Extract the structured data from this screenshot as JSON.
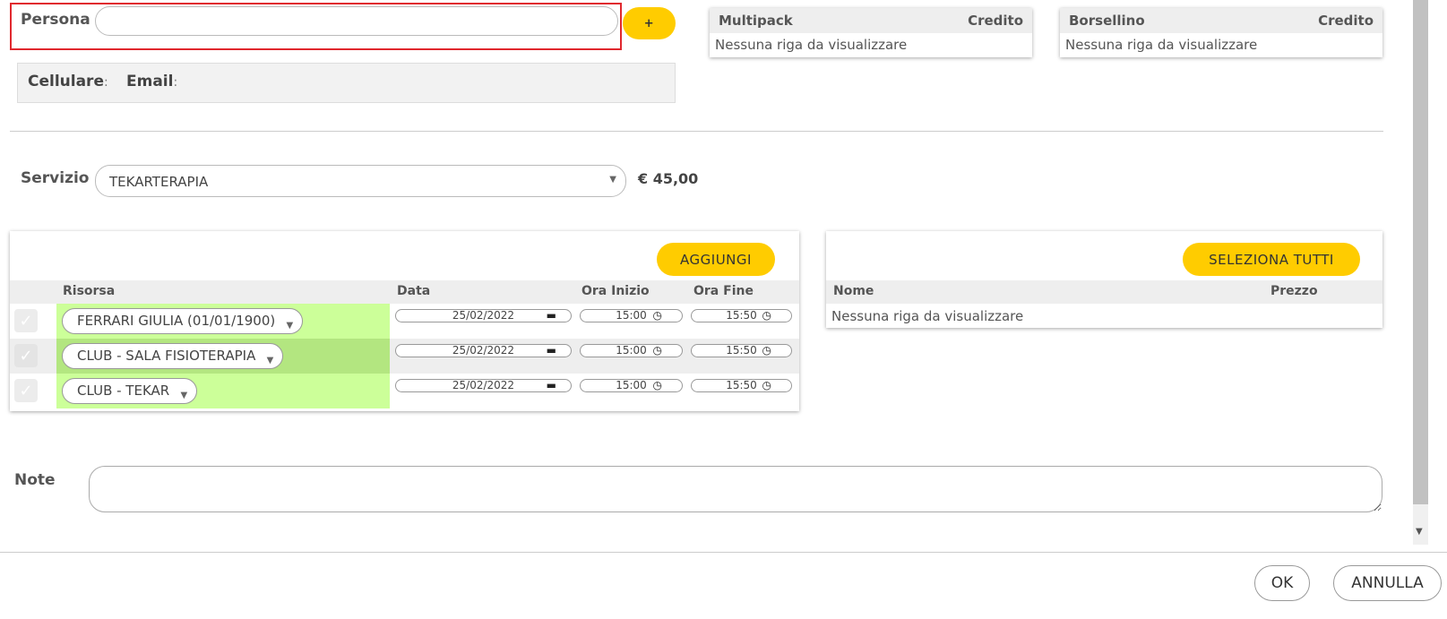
{
  "persona": {
    "label": "Persona",
    "value": "",
    "add_label": "+"
  },
  "contact": {
    "cellulare_label": "Cellulare",
    "email_label": "Email",
    "sep": ":"
  },
  "multipack": {
    "col_name": "Multipack",
    "col_credit": "Credito",
    "empty": "Nessuna riga da visualizzare"
  },
  "borsellino": {
    "col_name": "Borsellino",
    "col_credit": "Credito",
    "empty": "Nessuna riga da visualizzare"
  },
  "servizio": {
    "label": "Servizio",
    "value": "TEKARTERAPIA",
    "price": "€ 45,00"
  },
  "resources": {
    "add_label": "AGGIUNGI",
    "headers": {
      "risorsa": "Risorsa",
      "data": "Data",
      "ora_inizio": "Ora Inizio",
      "ora_fine": "Ora Fine"
    },
    "rows": [
      {
        "risorsa": "FERRARI GIULIA (01/01/1900)",
        "data": "25/02/2022",
        "inizio": "15:00",
        "fine": "15:50"
      },
      {
        "risorsa": "CLUB - SALA FISIOTERAPIA",
        "data": "25/02/2022",
        "inizio": "15:00",
        "fine": "15:50"
      },
      {
        "risorsa": "CLUB - TEKAR",
        "data": "25/02/2022",
        "inizio": "15:00",
        "fine": "15:50"
      }
    ]
  },
  "products": {
    "select_all_label": "SELEZIONA TUTTI",
    "headers": {
      "nome": "Nome",
      "prezzo": "Prezzo"
    },
    "empty": "Nessuna riga da visualizzare"
  },
  "note": {
    "label": "Note",
    "value": ""
  },
  "footer": {
    "ok_label": "OK",
    "cancel_label": "ANNULLA"
  },
  "colors": {
    "accent": "#ffcc00",
    "highlight_border": "#e0282e",
    "resource_green": "#ccff99",
    "resource_green_dark": "#b3e680"
  }
}
